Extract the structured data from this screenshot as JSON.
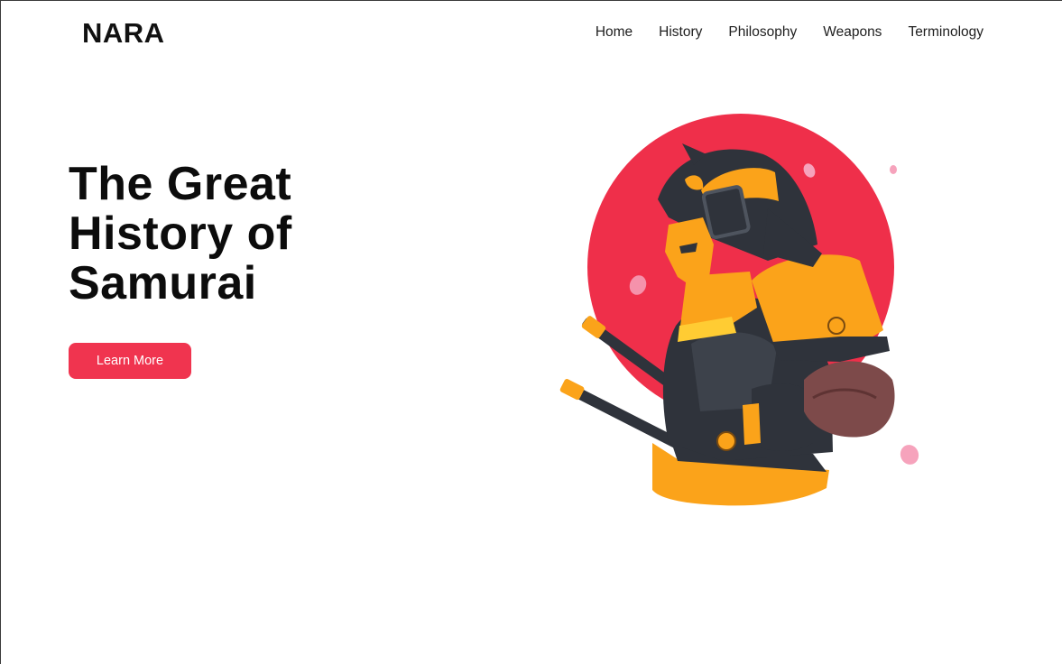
{
  "brand": {
    "logo_text": "NARA"
  },
  "nav": {
    "items": [
      {
        "label": "Home"
      },
      {
        "label": "History"
      },
      {
        "label": "Philosophy"
      },
      {
        "label": "Weapons"
      },
      {
        "label": "Terminology"
      }
    ]
  },
  "hero": {
    "title_line1": "The Great",
    "title_line2": "History of",
    "title_line3": "Samurai",
    "cta_label": "Learn More"
  },
  "colors": {
    "accent": "#f0344f",
    "sun": "#ef2f4a",
    "armor_dark": "#2f333b",
    "armor_orange": "#fba31a",
    "petal": "#f6a3bc"
  },
  "illustration": {
    "icon": "samurai-illustration"
  }
}
